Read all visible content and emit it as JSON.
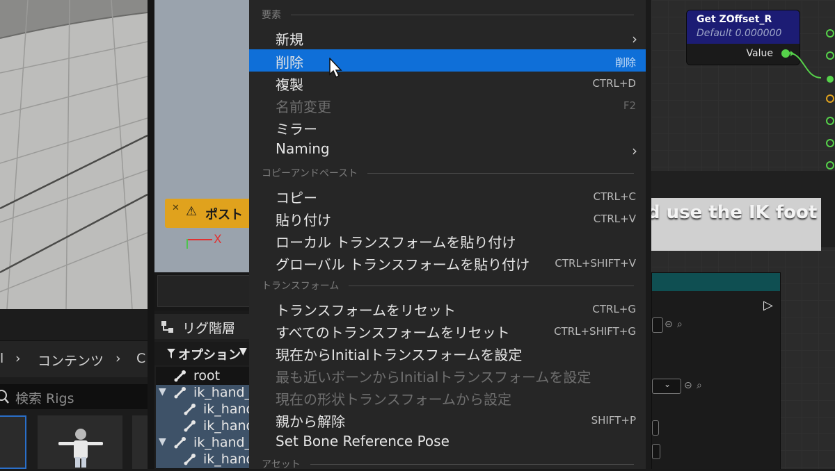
{
  "content_browser": {
    "path_items": [
      "l",
      "コンテンツ",
      "C"
    ],
    "path_separator": "›",
    "search_placeholder": "検索 Rigs"
  },
  "viewport": {
    "toast_text": "ポスト",
    "axis_label": "X"
  },
  "rig_hierarchy": {
    "tab_label": "リグ階層",
    "options_label": "オプション",
    "tree": [
      {
        "label": "root",
        "selected": false,
        "expanded": null
      },
      {
        "label": "ik_hand_",
        "selected": true,
        "expanded": true
      },
      {
        "label": "ik_hand",
        "selected": true,
        "expanded": null
      },
      {
        "label": "ik_hand",
        "selected": true,
        "expanded": null
      },
      {
        "label": "ik_hand_",
        "selected": true,
        "expanded": true
      },
      {
        "label": "ik_hand",
        "selected": true,
        "expanded": null
      }
    ]
  },
  "context_menu": {
    "sections": [
      {
        "title": "要素",
        "items": [
          {
            "label": "新規",
            "shortcut": "",
            "submenu": true,
            "disabled": false,
            "highlighted": false
          },
          {
            "label": "削除",
            "shortcut": "削除",
            "submenu": false,
            "disabled": false,
            "highlighted": true
          },
          {
            "label": "複製",
            "shortcut": "CTRL+D",
            "submenu": false,
            "disabled": false,
            "highlighted": false
          },
          {
            "label": "名前変更",
            "shortcut": "F2",
            "submenu": false,
            "disabled": true,
            "highlighted": false
          },
          {
            "label": "ミラー",
            "shortcut": "",
            "submenu": false,
            "disabled": false,
            "highlighted": false
          },
          {
            "label": "Naming",
            "shortcut": "",
            "submenu": true,
            "disabled": false,
            "highlighted": false
          }
        ]
      },
      {
        "title": "コピーアンドペースト",
        "items": [
          {
            "label": "コピー",
            "shortcut": "CTRL+C",
            "submenu": false,
            "disabled": false,
            "highlighted": false
          },
          {
            "label": "貼り付け",
            "shortcut": "CTRL+V",
            "submenu": false,
            "disabled": false,
            "highlighted": false
          },
          {
            "label": "ローカル トランスフォームを貼り付け",
            "shortcut": "",
            "submenu": false,
            "disabled": false,
            "highlighted": false
          },
          {
            "label": "グローバル トランスフォームを貼り付け",
            "shortcut": "CTRL+SHIFT+V",
            "submenu": false,
            "disabled": false,
            "highlighted": false
          }
        ]
      },
      {
        "title": "トランスフォーム",
        "items": [
          {
            "label": "トランスフォームをリセット",
            "shortcut": "CTRL+G",
            "submenu": false,
            "disabled": false,
            "highlighted": false
          },
          {
            "label": "すべてのトランスフォームをリセット",
            "shortcut": "CTRL+SHIFT+G",
            "submenu": false,
            "disabled": false,
            "highlighted": false
          },
          {
            "label": "現在からInitialトランスフォームを設定",
            "shortcut": "",
            "submenu": false,
            "disabled": false,
            "highlighted": false
          },
          {
            "label": "最も近いボーンからInitialトランスフォームを設定",
            "shortcut": "",
            "submenu": false,
            "disabled": true,
            "highlighted": false
          },
          {
            "label": "現在の形状トランスフォームから設定",
            "shortcut": "",
            "submenu": false,
            "disabled": true,
            "highlighted": false
          },
          {
            "label": "親から解除",
            "shortcut": "SHIFT+P",
            "submenu": false,
            "disabled": false,
            "highlighted": false
          },
          {
            "label": "Set Bone Reference Pose",
            "shortcut": "",
            "submenu": false,
            "disabled": false,
            "highlighted": false
          }
        ]
      },
      {
        "title": "アセット",
        "items": []
      }
    ]
  },
  "graph": {
    "node": {
      "title": "Get ZOffset_R",
      "subtitle": "Default 0.000000",
      "output_label": "Value",
      "header_color": "#1c1c74",
      "pin_color": "#56d24a"
    },
    "comment_text": "d use the IK foot"
  },
  "colors": {
    "highlight": "#0f6fd8",
    "toast": "#e0a21d",
    "selection": "#3e5268"
  }
}
